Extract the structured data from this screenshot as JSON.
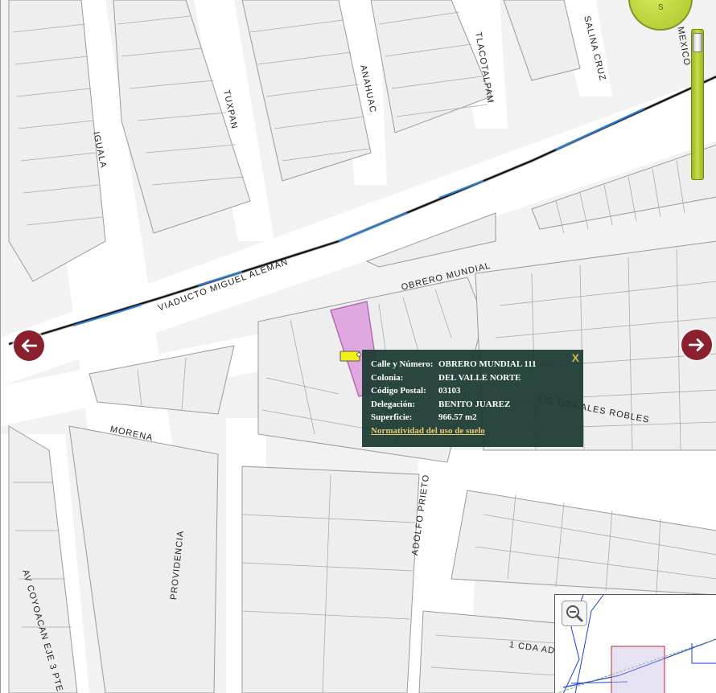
{
  "map": {
    "streets": [
      {
        "id": "iguala",
        "label": "IGUALA"
      },
      {
        "id": "tuxpan",
        "label": "TUXPAN"
      },
      {
        "id": "anahuac",
        "label": "ANAHUAC"
      },
      {
        "id": "tlacotalpam",
        "label": "TLACOTALPAM"
      },
      {
        "id": "salina-cruz",
        "label": "SALINA CRUZ"
      },
      {
        "id": "mexico",
        "label": "O MEXICO"
      },
      {
        "id": "viaducto",
        "label": "VIADUCTO MIGUEL ALEMAN"
      },
      {
        "id": "obrero-mundial",
        "label": "OBRERO MUNDIAL"
      },
      {
        "id": "morena",
        "label": "MORENA"
      },
      {
        "id": "lic-gonzales",
        "label": "LIC GRA ALES ROBLES"
      },
      {
        "id": "coyoacan",
        "label": "AV COYOACAN EJE 3 PTE."
      },
      {
        "id": "providencia",
        "label": "PROVIDENCIA"
      },
      {
        "id": "adolfo-prieto",
        "label": "ADOLFO PRIETO"
      },
      {
        "id": "cda",
        "label": "1 CDA AD"
      }
    ],
    "compass_letter": "S",
    "highlight_color": "#dfa9df",
    "popup_bg": "#1b3a32"
  },
  "popup": {
    "close_label": "X",
    "fields": [
      {
        "key": "Calle y Número:",
        "value": "OBRERO MUNDIAL 111"
      },
      {
        "key": "Colonia:",
        "value": "DEL VALLE NORTE"
      },
      {
        "key": "Código Postal:",
        "value": "03103"
      },
      {
        "key": "Delegación:",
        "value": "BENITO JUAREZ"
      },
      {
        "key": "Superficie:",
        "value": "966.57 m2"
      }
    ],
    "link_label": "Normatividad del uso de suelo"
  },
  "nav": {
    "left_icon": "arrow-left-icon",
    "right_icon": "arrow-right-icon"
  },
  "overview": {
    "zoom_icon": "zoom-out-icon"
  }
}
